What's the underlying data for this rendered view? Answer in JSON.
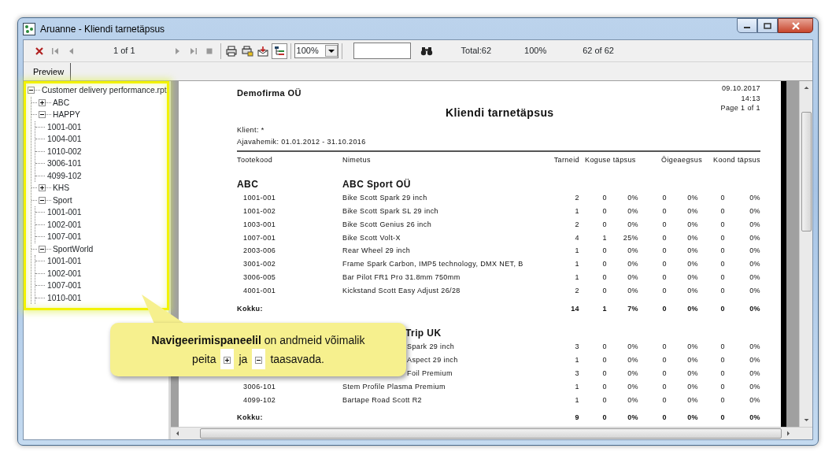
{
  "window": {
    "title": "Aruanne - Kliendi tarnetäpsus"
  },
  "toolbar": {
    "page_indicator": "1 of 1",
    "tree_toggle_on": true,
    "zoom": "100%",
    "total": "Total:62",
    "zoom_percent": "100%",
    "records": "62 of 62"
  },
  "tabs": [
    {
      "label": "Preview",
      "selected": true
    }
  ],
  "tree": {
    "label": "Customer delivery performance.rpt",
    "expanded": true,
    "children": [
      {
        "label": "ABC",
        "expanded": false
      },
      {
        "label": "HAPPY",
        "expanded": true,
        "children": [
          {
            "label": "1001-001"
          },
          {
            "label": "1004-001"
          },
          {
            "label": "1010-002"
          },
          {
            "label": "3006-101"
          },
          {
            "label": "4099-102"
          }
        ]
      },
      {
        "label": "KHS",
        "expanded": false
      },
      {
        "label": "Sport",
        "expanded": true,
        "children": [
          {
            "label": "1001-001"
          },
          {
            "label": "1002-001"
          },
          {
            "label": "1007-001"
          }
        ]
      },
      {
        "label": "SportWorld",
        "expanded": true,
        "children": [
          {
            "label": "1001-001"
          },
          {
            "label": "1002-001"
          },
          {
            "label": "1007-001"
          },
          {
            "label": "1010-001"
          }
        ]
      }
    ]
  },
  "report": {
    "company": "Demofirma OÜ",
    "title": "Kliendi tarnetäpsus",
    "date": "09.10.2017",
    "time": "14:13",
    "page": "Page 1 of 1",
    "filters": [
      "Klient: *",
      "Ajavahemik: 01.01.2012 - 31.10.2016"
    ],
    "columns": [
      "Tootekood",
      "Nimetus",
      "Tarneid",
      "Koguse täpsus",
      "Õigeaegsus",
      "Koond täpsus"
    ],
    "groups": [
      {
        "code": "ABC",
        "name": "ABC Sport OÜ",
        "total_label": "Kokku:",
        "totals": [
          "14",
          "1",
          "7%",
          "0",
          "0%",
          "0",
          "0%"
        ],
        "rows": [
          {
            "code": "1001-001",
            "name": "Bike Scott Spark 29 inch",
            "values": [
              "2",
              "0",
              "0%",
              "0",
              "0%",
              "0",
              "0%"
            ]
          },
          {
            "code": "1001-002",
            "name": "Bike Scott Spark SL 29 inch",
            "values": [
              "1",
              "0",
              "0%",
              "0",
              "0%",
              "0",
              "0%"
            ]
          },
          {
            "code": "1003-001",
            "name": "Bike Scott Genius 26 inch",
            "values": [
              "2",
              "0",
              "0%",
              "0",
              "0%",
              "0",
              "0%"
            ]
          },
          {
            "code": "1007-001",
            "name": "Bike Scott Volt-X",
            "values": [
              "4",
              "1",
              "25%",
              "0",
              "0%",
              "0",
              "0%"
            ]
          },
          {
            "code": "2003-006",
            "name": "Rear Wheel 29 inch",
            "values": [
              "1",
              "0",
              "0%",
              "0",
              "0%",
              "0",
              "0%"
            ]
          },
          {
            "code": "3001-002",
            "name": "Frame Spark Carbon, IMP5 technology, DMX NET, B",
            "values": [
              "1",
              "0",
              "0%",
              "0",
              "0%",
              "0",
              "0%"
            ]
          },
          {
            "code": "3006-005",
            "name": "Bar Pilot FR1 Pro 31.8mm 750mm",
            "values": [
              "1",
              "0",
              "0%",
              "0",
              "0%",
              "0",
              "0%"
            ]
          },
          {
            "code": "4001-001",
            "name": "Kickstand Scott Easy Adjust 26/28",
            "values": [
              "2",
              "0",
              "0%",
              "0",
              "0%",
              "0",
              "0%"
            ]
          }
        ]
      },
      {
        "name": "Trip UK",
        "kind": "partial",
        "total_label": "Kokku:",
        "totals": [
          "9",
          "0",
          "0%",
          "0",
          "0%",
          "0",
          "0%"
        ],
        "rows": [
          {
            "kind": "partial",
            "name": "Spark 29 inch",
            "values": [
              "3",
              "0",
              "0%",
              "0",
              "0%",
              "0",
              "0%"
            ]
          },
          {
            "kind": "partial",
            "name": "Aspect 29 inch",
            "values": [
              "1",
              "0",
              "0%",
              "0",
              "0%",
              "0",
              "0%"
            ]
          },
          {
            "kind": "partial",
            "name": "Foil Premium",
            "values": [
              "3",
              "0",
              "0%",
              "0",
              "0%",
              "0",
              "0%"
            ]
          },
          {
            "code": "3006-101",
            "name": "Stem Profile Plasma Premium",
            "values": [
              "1",
              "0",
              "0%",
              "0",
              "0%",
              "0",
              "0%"
            ]
          },
          {
            "code": "4099-102",
            "name": "Bartape Road Scott R2",
            "values": [
              "1",
              "0",
              "0%",
              "0",
              "0%",
              "0",
              "0%"
            ]
          }
        ]
      }
    ]
  },
  "callout": {
    "line_1": "**Navigeerimispaneelil** on andmeid võimalik",
    "word_1": "peita",
    "word_2": "ja",
    "word_3": "taasavada."
  }
}
